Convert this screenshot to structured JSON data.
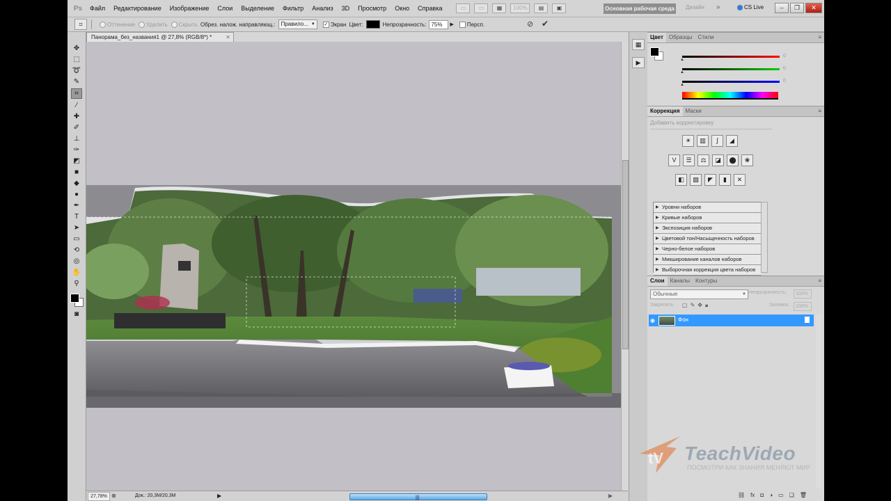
{
  "menubar": {
    "logo": "Ps",
    "items": [
      "Файл",
      "Редактирование",
      "Изображение",
      "Слои",
      "Выделение",
      "Фильтр",
      "Анализ",
      "3D",
      "Просмотр",
      "Окно",
      "Справка"
    ],
    "zoom": "100%",
    "workspace": "Основная рабочая среда",
    "design": "Дизайн",
    "more": "»",
    "cslive": "CS Live"
  },
  "options": {
    "shield": "Оттенение",
    "delete": "Удалить",
    "hide": "Скрыть",
    "overlay_label": "Обрез. налож. направляющ.:",
    "overlay_value": "Правило...",
    "screen": "Экран",
    "color_label": "Цвет:",
    "opacity_label": "Непрозрачность:",
    "opacity_value": "75%",
    "perspective": "Персп."
  },
  "document": {
    "tab_title": "Панорама_без_названия1 @ 27,8% (RGB/8*) *",
    "zoom": "27,78%",
    "doc_info": "Док.: 20,3M/20,3M"
  },
  "panels": {
    "color_tabs": [
      "Цвет",
      "Образцы",
      "Стили"
    ],
    "color_values": [
      "0",
      "0",
      "0"
    ],
    "adjust_tabs": [
      "Коррекция",
      "Маски"
    ],
    "adjust_subtitle": "Добавить корректировку",
    "presets": [
      "Уровни наборов",
      "Кривые наборов",
      "Экспозиция наборов",
      "Цветовой тон/Насыщенность наборов",
      "Черно-белое наборов",
      "Микширование каналов наборов",
      "Выборочная коррекция цвета наборов"
    ],
    "layers_tabs": [
      "Слои",
      "Каналы",
      "Контуры"
    ],
    "blend_mode": "Обычные",
    "opacity_label": "Непрозрачность:",
    "opacity_value": "100%",
    "lock_label": "Закрепить:",
    "fill_label": "Заливка:",
    "fill_value": "100%",
    "layer_name": "Фон"
  },
  "watermark": {
    "title": "TeachVideo",
    "subtitle": "ПОСМОТРИ КАК ЗНАНИЯ МЕНЯЮТ МИР"
  },
  "colors": {
    "selection": "#3399ff",
    "canvas_bg": "#c2c0c6",
    "workspace_btn": "#8e8e8e"
  }
}
